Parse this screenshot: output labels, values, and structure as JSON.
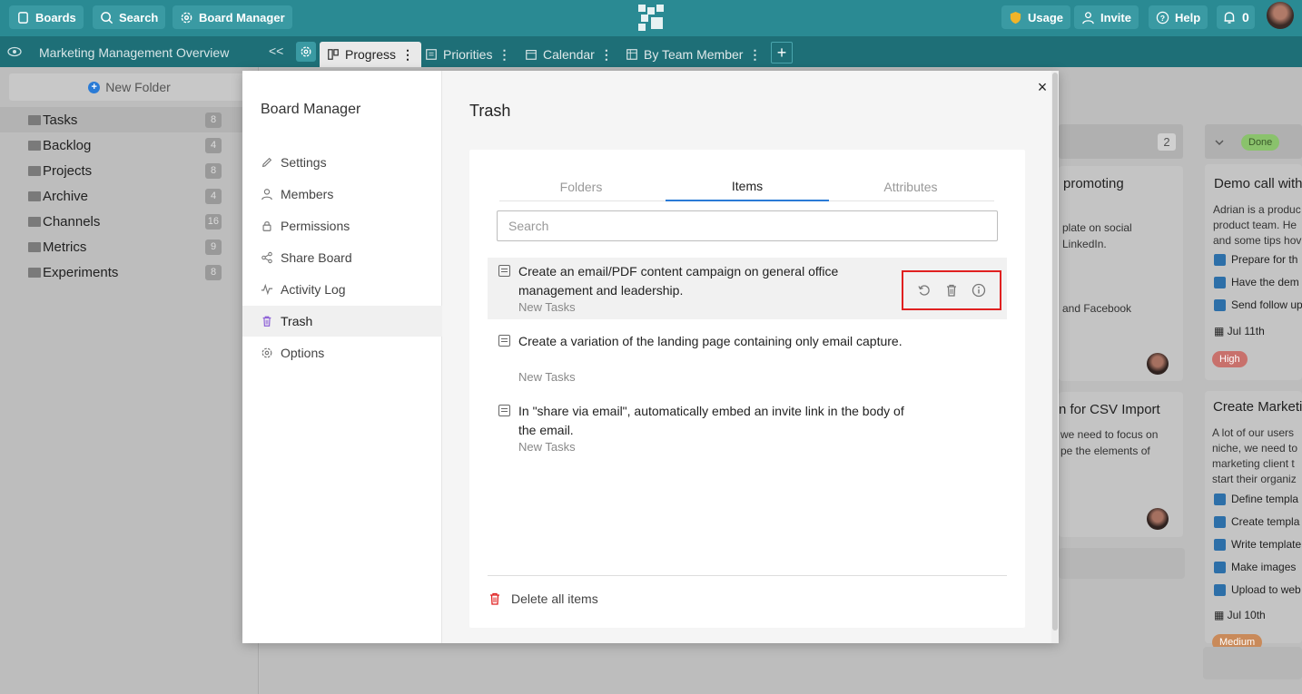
{
  "topbar": {
    "boards_label": "Boards",
    "search_label": "Search",
    "board_manager_label": "Board Manager",
    "usage_label": "Usage",
    "invite_label": "Invite",
    "help_label": "Help",
    "notifications_count": "0"
  },
  "viewbar": {
    "board_name": "Marketing Management Overview",
    "collapse_glyph": "<<",
    "tabs": [
      {
        "label": "Progress",
        "icon": "board-icon"
      },
      {
        "label": "Priorities",
        "icon": "list-icon"
      },
      {
        "label": "Calendar",
        "icon": "calendar-icon"
      },
      {
        "label": "By Team Member",
        "icon": "table-icon"
      }
    ],
    "add_glyph": "+"
  },
  "sidebar": {
    "new_folder_label": "New Folder",
    "folders": [
      {
        "name": "Tasks",
        "count": "8"
      },
      {
        "name": "Backlog",
        "count": "4"
      },
      {
        "name": "Projects",
        "count": "8"
      },
      {
        "name": "Archive",
        "count": "4"
      },
      {
        "name": "Channels",
        "count": "16"
      },
      {
        "name": "Metrics",
        "count": "9"
      },
      {
        "name": "Experiments",
        "count": "8"
      }
    ]
  },
  "board": {
    "col_count": "2",
    "done_label": "Done",
    "card1_title": "promoting",
    "card1_line1": "plate on social",
    "card1_line2": "LinkedIn.",
    "card1_line3": "and Facebook",
    "card2_title": "n for CSV Import",
    "card2_line1": "we need to focus on",
    "card2_line2": "pe the elements of",
    "done_card1": {
      "title": "Demo call with",
      "lines": [
        "Adrian is a produc",
        "product team. He",
        "and some tips hov"
      ],
      "checks": [
        "Prepare for th",
        "Have the dem",
        "Send follow up"
      ],
      "date": "Jul 11th",
      "priority": "High"
    },
    "done_card2": {
      "title": "Create Marketin",
      "lines": [
        "A lot of our users",
        "niche, we need to",
        "marketing client t",
        "start their organiz"
      ],
      "checks": [
        "Define templa",
        "Create templa",
        "Write template",
        "Make images",
        "Upload to web"
      ],
      "date": "Jul 10th",
      "priority": "Medium"
    }
  },
  "modal": {
    "title": "Board Manager",
    "nav": [
      {
        "label": "Settings",
        "icon": "pencil-icon"
      },
      {
        "label": "Members",
        "icon": "user-icon"
      },
      {
        "label": "Permissions",
        "icon": "lock-icon"
      },
      {
        "label": "Share Board",
        "icon": "share-icon"
      },
      {
        "label": "Activity Log",
        "icon": "activity-icon"
      },
      {
        "label": "Trash",
        "icon": "trash-icon"
      },
      {
        "label": "Options",
        "icon": "gear-icon"
      }
    ],
    "close_glyph": "×",
    "content_title": "Trash",
    "tabs": [
      "Folders",
      "Items",
      "Attributes"
    ],
    "active_tab": "Items",
    "search_placeholder": "Search",
    "items": [
      {
        "title": "Create an email/PDF content campaign on general office management and leadership.",
        "folder": "New Tasks"
      },
      {
        "title": "Create a variation of the landing page containing only email capture.",
        "folder": "New Tasks"
      },
      {
        "title": "In \"share via email\", automatically embed an invite link in the body of the email.",
        "folder": "New Tasks"
      }
    ],
    "delete_all_label": "Delete all items"
  },
  "colors": {
    "topbar": "#2a8a93",
    "viewbar": "#1e6f77",
    "accent_blue": "#2a7bd6",
    "trash_purple": "#8a5cd6",
    "danger_red": "#e02020",
    "done_green": "#8ad26c",
    "high_red": "#d9534f",
    "medium_orange": "#e8904a"
  }
}
